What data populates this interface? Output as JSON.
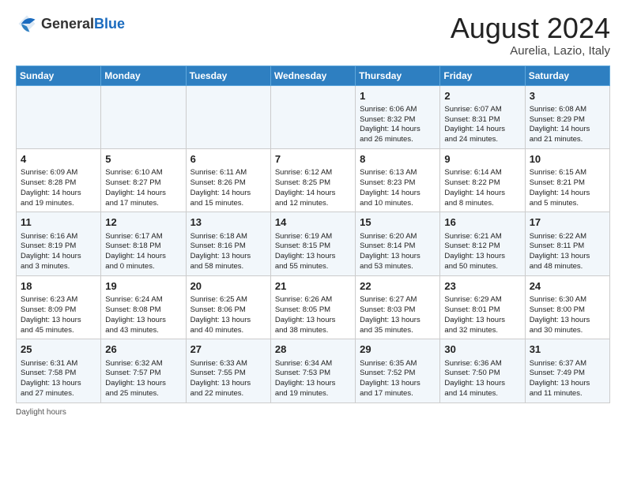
{
  "header": {
    "logo_general": "General",
    "logo_blue": "Blue",
    "month_year": "August 2024",
    "location": "Aurelia, Lazio, Italy"
  },
  "days_of_week": [
    "Sunday",
    "Monday",
    "Tuesday",
    "Wednesday",
    "Thursday",
    "Friday",
    "Saturday"
  ],
  "footer": "Daylight hours",
  "weeks": [
    [
      {
        "day": "",
        "text": ""
      },
      {
        "day": "",
        "text": ""
      },
      {
        "day": "",
        "text": ""
      },
      {
        "day": "",
        "text": ""
      },
      {
        "day": "1",
        "text": "Sunrise: 6:06 AM\nSunset: 8:32 PM\nDaylight: 14 hours\nand 26 minutes."
      },
      {
        "day": "2",
        "text": "Sunrise: 6:07 AM\nSunset: 8:31 PM\nDaylight: 14 hours\nand 24 minutes."
      },
      {
        "day": "3",
        "text": "Sunrise: 6:08 AM\nSunset: 8:29 PM\nDaylight: 14 hours\nand 21 minutes."
      }
    ],
    [
      {
        "day": "4",
        "text": "Sunrise: 6:09 AM\nSunset: 8:28 PM\nDaylight: 14 hours\nand 19 minutes."
      },
      {
        "day": "5",
        "text": "Sunrise: 6:10 AM\nSunset: 8:27 PM\nDaylight: 14 hours\nand 17 minutes."
      },
      {
        "day": "6",
        "text": "Sunrise: 6:11 AM\nSunset: 8:26 PM\nDaylight: 14 hours\nand 15 minutes."
      },
      {
        "day": "7",
        "text": "Sunrise: 6:12 AM\nSunset: 8:25 PM\nDaylight: 14 hours\nand 12 minutes."
      },
      {
        "day": "8",
        "text": "Sunrise: 6:13 AM\nSunset: 8:23 PM\nDaylight: 14 hours\nand 10 minutes."
      },
      {
        "day": "9",
        "text": "Sunrise: 6:14 AM\nSunset: 8:22 PM\nDaylight: 14 hours\nand 8 minutes."
      },
      {
        "day": "10",
        "text": "Sunrise: 6:15 AM\nSunset: 8:21 PM\nDaylight: 14 hours\nand 5 minutes."
      }
    ],
    [
      {
        "day": "11",
        "text": "Sunrise: 6:16 AM\nSunset: 8:19 PM\nDaylight: 14 hours\nand 3 minutes."
      },
      {
        "day": "12",
        "text": "Sunrise: 6:17 AM\nSunset: 8:18 PM\nDaylight: 14 hours\nand 0 minutes."
      },
      {
        "day": "13",
        "text": "Sunrise: 6:18 AM\nSunset: 8:16 PM\nDaylight: 13 hours\nand 58 minutes."
      },
      {
        "day": "14",
        "text": "Sunrise: 6:19 AM\nSunset: 8:15 PM\nDaylight: 13 hours\nand 55 minutes."
      },
      {
        "day": "15",
        "text": "Sunrise: 6:20 AM\nSunset: 8:14 PM\nDaylight: 13 hours\nand 53 minutes."
      },
      {
        "day": "16",
        "text": "Sunrise: 6:21 AM\nSunset: 8:12 PM\nDaylight: 13 hours\nand 50 minutes."
      },
      {
        "day": "17",
        "text": "Sunrise: 6:22 AM\nSunset: 8:11 PM\nDaylight: 13 hours\nand 48 minutes."
      }
    ],
    [
      {
        "day": "18",
        "text": "Sunrise: 6:23 AM\nSunset: 8:09 PM\nDaylight: 13 hours\nand 45 minutes."
      },
      {
        "day": "19",
        "text": "Sunrise: 6:24 AM\nSunset: 8:08 PM\nDaylight: 13 hours\nand 43 minutes."
      },
      {
        "day": "20",
        "text": "Sunrise: 6:25 AM\nSunset: 8:06 PM\nDaylight: 13 hours\nand 40 minutes."
      },
      {
        "day": "21",
        "text": "Sunrise: 6:26 AM\nSunset: 8:05 PM\nDaylight: 13 hours\nand 38 minutes."
      },
      {
        "day": "22",
        "text": "Sunrise: 6:27 AM\nSunset: 8:03 PM\nDaylight: 13 hours\nand 35 minutes."
      },
      {
        "day": "23",
        "text": "Sunrise: 6:29 AM\nSunset: 8:01 PM\nDaylight: 13 hours\nand 32 minutes."
      },
      {
        "day": "24",
        "text": "Sunrise: 6:30 AM\nSunset: 8:00 PM\nDaylight: 13 hours\nand 30 minutes."
      }
    ],
    [
      {
        "day": "25",
        "text": "Sunrise: 6:31 AM\nSunset: 7:58 PM\nDaylight: 13 hours\nand 27 minutes."
      },
      {
        "day": "26",
        "text": "Sunrise: 6:32 AM\nSunset: 7:57 PM\nDaylight: 13 hours\nand 25 minutes."
      },
      {
        "day": "27",
        "text": "Sunrise: 6:33 AM\nSunset: 7:55 PM\nDaylight: 13 hours\nand 22 minutes."
      },
      {
        "day": "28",
        "text": "Sunrise: 6:34 AM\nSunset: 7:53 PM\nDaylight: 13 hours\nand 19 minutes."
      },
      {
        "day": "29",
        "text": "Sunrise: 6:35 AM\nSunset: 7:52 PM\nDaylight: 13 hours\nand 17 minutes."
      },
      {
        "day": "30",
        "text": "Sunrise: 6:36 AM\nSunset: 7:50 PM\nDaylight: 13 hours\nand 14 minutes."
      },
      {
        "day": "31",
        "text": "Sunrise: 6:37 AM\nSunset: 7:49 PM\nDaylight: 13 hours\nand 11 minutes."
      }
    ]
  ]
}
